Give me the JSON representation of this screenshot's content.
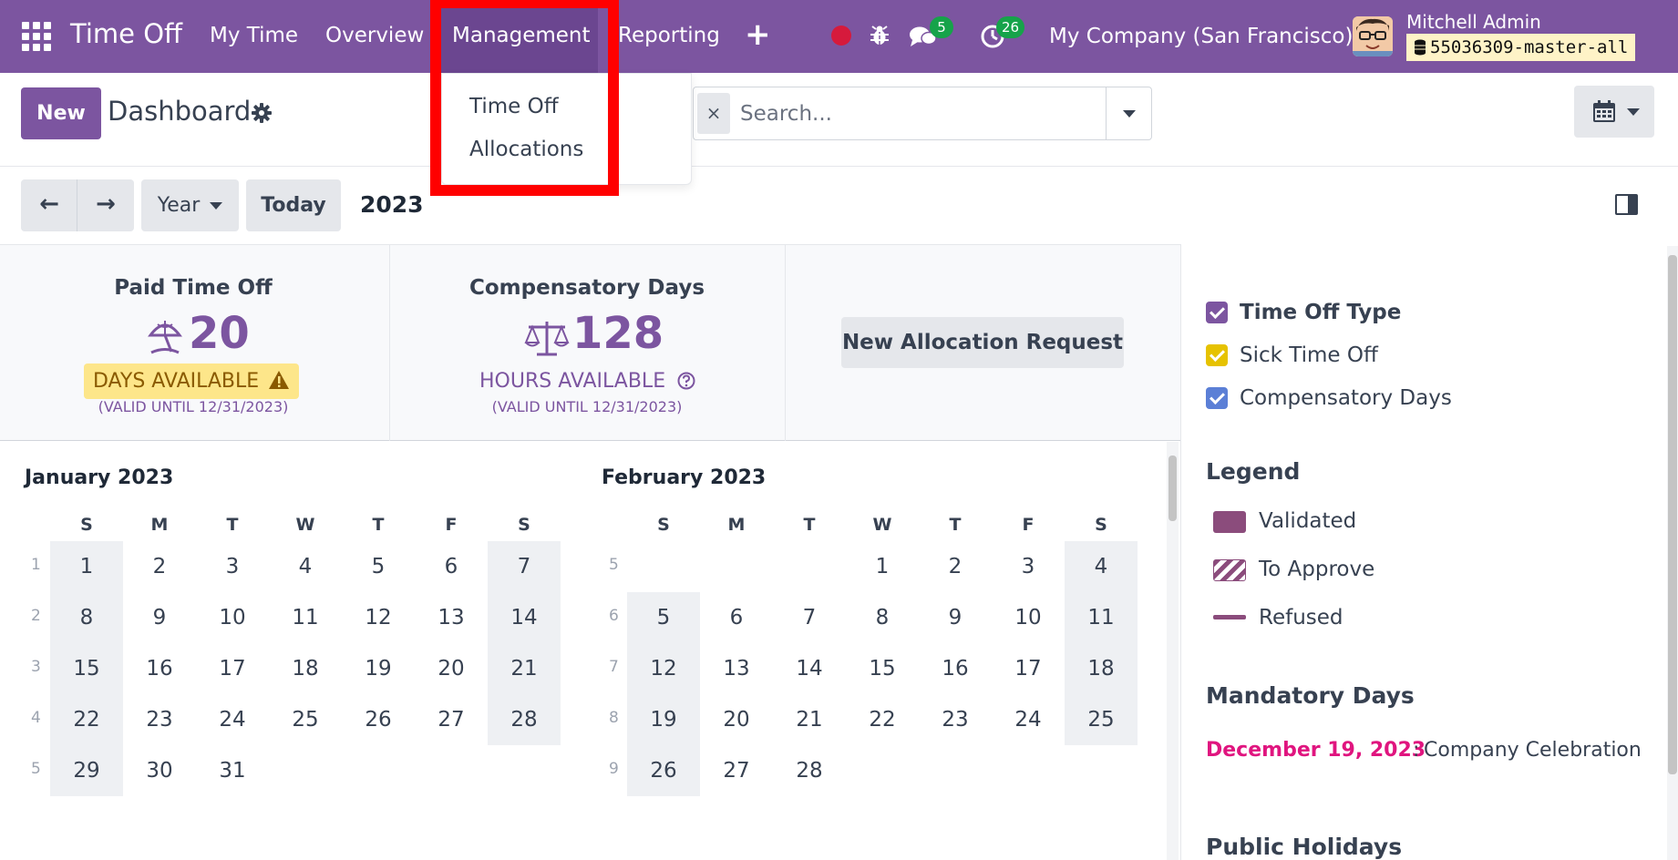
{
  "navbar": {
    "brand": "Time Off",
    "menus": [
      "My Time",
      "Overview",
      "Management",
      "Reporting"
    ],
    "plus": "+",
    "chat_badge": "5",
    "activity_badge": "26",
    "company": "My Company (San Francisco)",
    "user_name": "Mitchell Admin",
    "db_name": "55036309-master-all"
  },
  "dropdown": {
    "items": [
      "Time Off",
      "Allocations"
    ]
  },
  "control_panel": {
    "new_label": "New",
    "breadcrumb": "Dashboard",
    "search_placeholder": "Search...",
    "clear": "×"
  },
  "calendar_controls": {
    "prev": "←",
    "next": "→",
    "scale": "Year",
    "today": "Today",
    "current_year": "2023"
  },
  "summary": {
    "paid": {
      "title": "Paid Time Off",
      "value": "20",
      "unit": "DAYS AVAILABLE",
      "valid": "(VALID UNTIL 12/31/2023)"
    },
    "comp": {
      "title": "Compensatory Days",
      "value": "128",
      "unit": "HOURS AVAILABLE",
      "valid": "(VALID UNTIL 12/31/2023)"
    },
    "alloc_button": "New Allocation Request"
  },
  "months": [
    {
      "title": "January 2023",
      "weekdays": [
        "S",
        "M",
        "T",
        "W",
        "T",
        "F",
        "S"
      ],
      "weeks": [
        {
          "num": "1",
          "days": [
            "1",
            "2",
            "3",
            "4",
            "5",
            "6",
            "7"
          ]
        },
        {
          "num": "2",
          "days": [
            "8",
            "9",
            "10",
            "11",
            "12",
            "13",
            "14"
          ]
        },
        {
          "num": "3",
          "days": [
            "15",
            "16",
            "17",
            "18",
            "19",
            "20",
            "21"
          ]
        },
        {
          "num": "4",
          "days": [
            "22",
            "23",
            "24",
            "25",
            "26",
            "27",
            "28"
          ]
        },
        {
          "num": "5",
          "days": [
            "29",
            "30",
            "31",
            "",
            "",
            "",
            ""
          ]
        }
      ]
    },
    {
      "title": "February 2023",
      "weekdays": [
        "S",
        "M",
        "T",
        "W",
        "T",
        "F",
        "S"
      ],
      "weeks": [
        {
          "num": "5",
          "days": [
            "",
            "",
            "",
            "1",
            "2",
            "3",
            "4"
          ]
        },
        {
          "num": "6",
          "days": [
            "5",
            "6",
            "7",
            "8",
            "9",
            "10",
            "11"
          ]
        },
        {
          "num": "7",
          "days": [
            "12",
            "13",
            "14",
            "15",
            "16",
            "17",
            "18"
          ]
        },
        {
          "num": "8",
          "days": [
            "19",
            "20",
            "21",
            "22",
            "23",
            "24",
            "25"
          ]
        },
        {
          "num": "9",
          "days": [
            "26",
            "27",
            "28",
            "",
            "",
            "",
            ""
          ]
        }
      ]
    }
  ],
  "side_panel": {
    "filters": [
      {
        "label": "Time Off Type",
        "color": "#7c55a0"
      },
      {
        "label": "Sick Time Off",
        "color": "#e6c200"
      },
      {
        "label": "Compensatory Days",
        "color": "#5b7fd6"
      }
    ],
    "legend_title": "Legend",
    "legend": [
      "Validated",
      "To Approve",
      "Refused"
    ],
    "legend_color": "#8b4c7c",
    "mandatory_title": "Mandatory Days",
    "mandatory_date": "December 19, 2023",
    "mandatory_sep": ":",
    "mandatory_name": "Company Celebration",
    "holidays_title": "Public Holidays"
  },
  "colors": {
    "brand": "#7c55a0",
    "highlight": "#ff0000"
  }
}
